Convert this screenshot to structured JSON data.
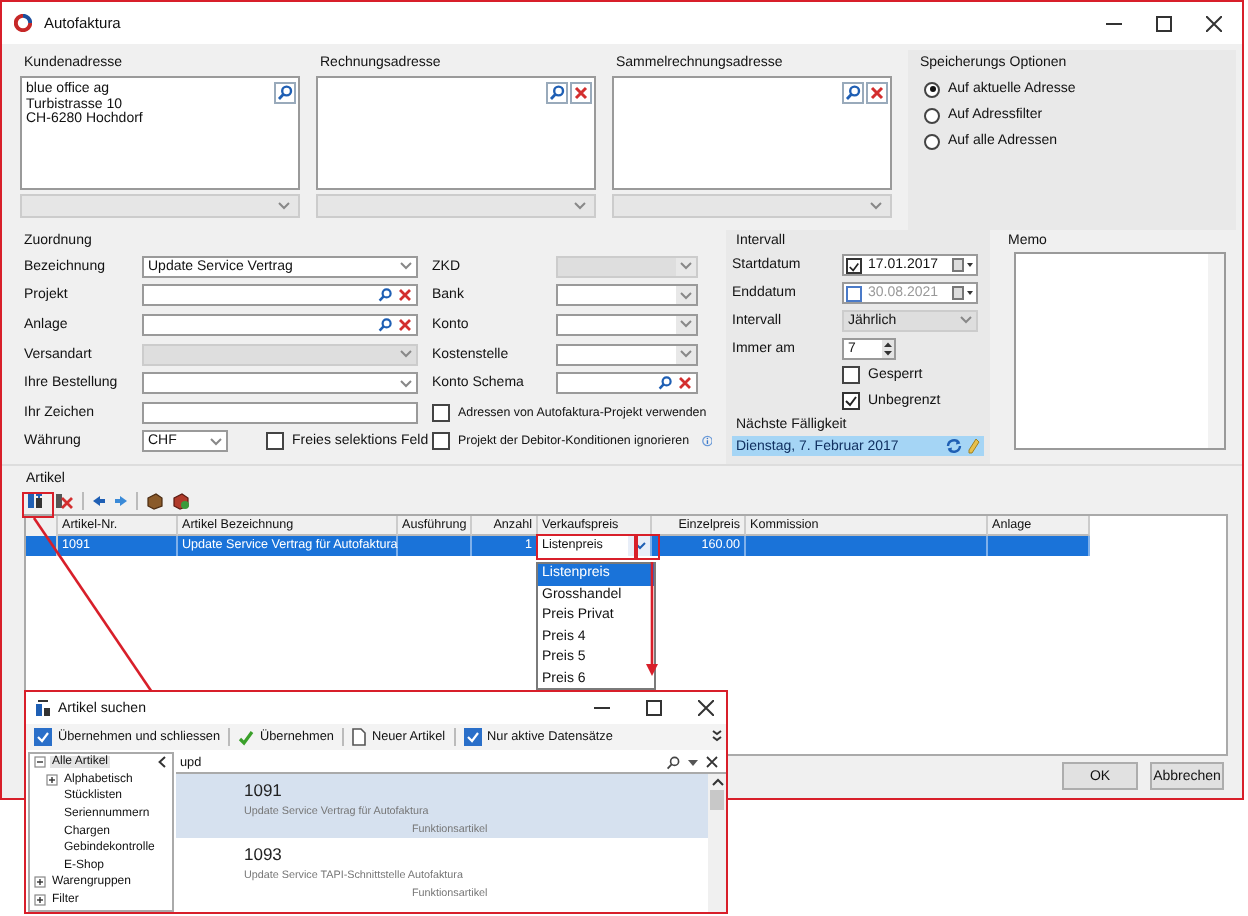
{
  "window": {
    "title": "Autofaktura"
  },
  "address_groups": [
    {
      "title": "Kundenadresse",
      "lines": [
        "blue office ag",
        "Turbistrasse 10",
        "CH-6280 Hochdorf"
      ],
      "clearable": false
    },
    {
      "title": "Rechnungsadresse",
      "clearable": true
    },
    {
      "title": "Sammelrechnungsadresse",
      "clearable": true
    }
  ],
  "save_options": {
    "title": "Speicherungs Optionen",
    "options": [
      {
        "label": "Auf aktuelle Adresse",
        "selected": true
      },
      {
        "label": "Auf Adressfilter",
        "selected": false
      },
      {
        "label": "Auf alle Adressen",
        "selected": false
      }
    ]
  },
  "assignment": {
    "title": "Zuordnung",
    "fields": [
      {
        "label": "Bezeichnung",
        "kind": "combo",
        "value": "Update Service Vertrag",
        "disabled": false
      },
      {
        "label": "Projekt",
        "kind": "lookup",
        "disabled": false
      },
      {
        "label": "Anlage",
        "kind": "lookup",
        "disabled": false
      },
      {
        "label": "Versandart",
        "kind": "combo",
        "disabled": true
      },
      {
        "label": "Ihre Bestellung",
        "kind": "combo",
        "disabled": false
      },
      {
        "label": "Ihr Zeichen",
        "kind": "text",
        "disabled": false
      },
      {
        "label": "Währung",
        "kind": "currency",
        "value": "CHF",
        "disabled": false
      }
    ],
    "free_selection": {
      "label": "Freies selektions Feld",
      "checked": false
    },
    "fields_2": [
      {
        "label": "ZKD",
        "kind": "combo",
        "disabled": true
      },
      {
        "label": "Bank",
        "kind": "combo",
        "disabled": false
      },
      {
        "label": "Konto",
        "kind": "combo",
        "disabled": false
      },
      {
        "label": "Kostenstelle",
        "kind": "combo",
        "disabled": false
      },
      {
        "label": "Konto Schema",
        "kind": "lookup",
        "disabled": false
      }
    ],
    "options": [
      {
        "label": "Adressen von Autofaktura-Projekt verwenden",
        "checked": false
      },
      {
        "label": "Projekt der Debitor-Konditionen ignorieren",
        "checked": false,
        "info": true
      }
    ]
  },
  "interval": {
    "title": "Intervall",
    "start": {
      "label": "Startdatum",
      "checked": true,
      "value": "17.01.2017"
    },
    "end": {
      "label": "Enddatum",
      "checked": false,
      "value": "30.08.2021"
    },
    "interval": {
      "label": "Intervall",
      "value": "Jährlich",
      "disabled": true
    },
    "day": {
      "label": "Immer am",
      "value": "7"
    },
    "blocked": {
      "label": "Gesperrt",
      "checked": false
    },
    "unlimited": {
      "label": "Unbegrenzt",
      "checked": true
    },
    "next_due": {
      "label": "Nächste Fälligkeit",
      "value": "Dienstag, 7. Februar 2017"
    }
  },
  "memo": {
    "title": "Memo"
  },
  "articles": {
    "title": "Artikel",
    "columns": [
      "Artikel-Nr.",
      "Artikel Bezeichnung",
      "Ausführung",
      "Anzahl",
      "Verkaufspreis",
      "Einzelpreis",
      "Kommission",
      "Anlage"
    ],
    "rows": [
      {
        "artikel_nr": "1091",
        "bezeichnung": "Update Service Vertrag für Autofaktura",
        "anzahl": "1",
        "verkaufspreis": "Listenpreis",
        "einzelpreis": "160.00",
        "selected": true
      }
    ]
  },
  "price_dropdown": {
    "options": [
      {
        "label": "Listenpreis",
        "selected": true
      },
      {
        "label": "Grosshandel",
        "selected": false
      },
      {
        "label": "Preis Privat",
        "selected": false
      },
      {
        "label": "Preis 4",
        "selected": false
      },
      {
        "label": "Preis 5",
        "selected": false
      },
      {
        "label": "Preis 6",
        "selected": false
      }
    ]
  },
  "buttons": [
    "OK",
    "Abbrechen"
  ],
  "search_dialog": {
    "title": "Artikel suchen",
    "toolbar": [
      {
        "kind": "check",
        "label": "Übernehmen und schliessen",
        "checked": true
      },
      {
        "kind": "accept",
        "label": "Übernehmen"
      },
      {
        "kind": "new",
        "label": "Neuer Artikel"
      },
      {
        "kind": "check",
        "label": "Nur aktive Datensätze",
        "checked": true
      }
    ],
    "tree": [
      {
        "label": "Alle Artikel",
        "kind": "folder",
        "expanded": true,
        "selected": true,
        "children": [
          {
            "label": "Alphabetisch",
            "kind": "folder",
            "expanded": false,
            "selected": false
          },
          {
            "label": "Stücklisten",
            "kind": "leaf",
            "selected": false
          },
          {
            "label": "Seriennummern",
            "kind": "leaf",
            "selected": false
          },
          {
            "label": "Chargen",
            "kind": "leaf",
            "selected": false
          },
          {
            "label": "Gebindekontrolle",
            "kind": "leaf",
            "selected": false
          },
          {
            "label": "E-Shop",
            "kind": "leaf",
            "selected": false
          }
        ]
      },
      {
        "label": "Warengruppen",
        "kind": "folder",
        "expanded": false,
        "selected": false
      },
      {
        "label": "Filter",
        "kind": "folder",
        "expanded": false,
        "selected": false
      }
    ],
    "search": {
      "value": "upd"
    },
    "results": [
      {
        "number": "1091",
        "name": "Update Service Vertrag für Autofaktura",
        "type": "Funktionsartikel",
        "selected": true
      },
      {
        "number": "1093",
        "name": "Update Service TAPI-Schnittstelle Autofaktura",
        "type": "Funktionsartikel",
        "selected": false
      }
    ]
  }
}
